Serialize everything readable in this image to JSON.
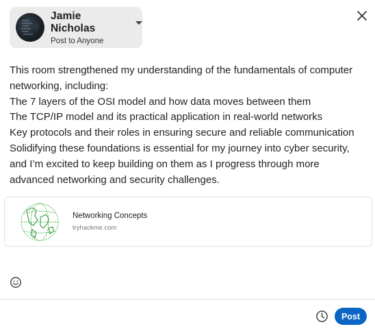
{
  "author": {
    "name": "Jamie Nicholas",
    "visibility": "Post to Anyone"
  },
  "post": {
    "lines": [
      "This room strengthened my understanding of the fundamentals of computer",
      "networking, including:",
      "The 7 layers of the OSI model and how data moves between them",
      "The TCP/IP model and its practical application in real-world networks",
      "Key protocols and their roles in ensuring secure and reliable communication",
      "Solidifying these foundations is essential for my journey into cyber security,",
      "and I’m excited to keep building on them as I progress through more",
      "advanced networking and security challenges."
    ]
  },
  "link_preview": {
    "title": "Networking Concepts",
    "domain": "tryhackme.com"
  },
  "footer": {
    "post_label": "Post"
  },
  "icons": {
    "close": "close-icon",
    "emoji": "emoji-icon",
    "schedule": "clock-icon",
    "caret": "caret-down-icon",
    "globe": "globe-icon"
  },
  "colors": {
    "accent": "#0a66c2",
    "chip_bg": "#ebebeb",
    "globe_green": "#3cb043"
  }
}
